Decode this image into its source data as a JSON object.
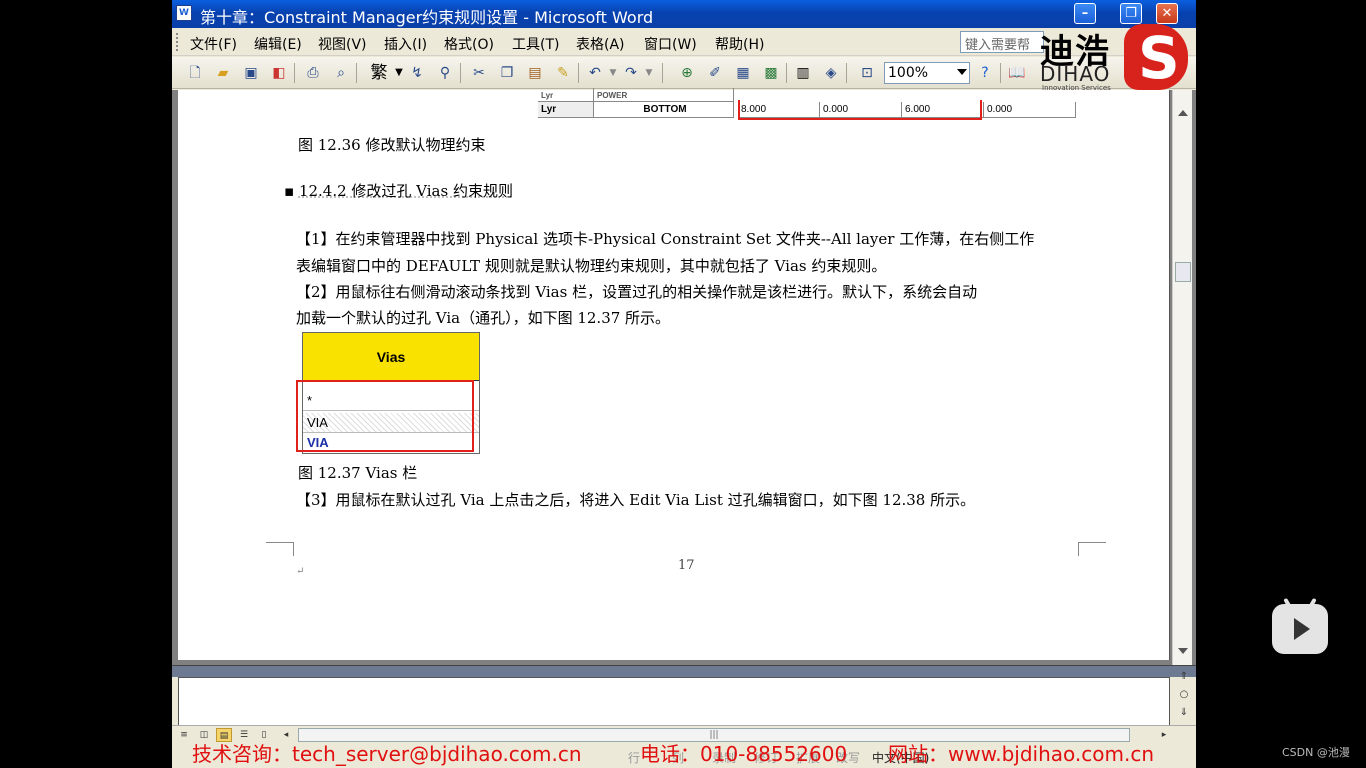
{
  "window": {
    "title": "第十章：Constraint Manager约束规则设置 - Microsoft Word",
    "app_icon": "W",
    "buttons": {
      "minimize": "–",
      "restore": "❐",
      "close": "✕"
    }
  },
  "menu": {
    "items": [
      "文件(F)",
      "编辑(E)",
      "视图(V)",
      "插入(I)",
      "格式(O)",
      "工具(T)",
      "表格(A)",
      "窗口(W)",
      "帮助(H)"
    ],
    "help_placeholder": "键入需要帮"
  },
  "toolbar": {
    "zoom": "100%",
    "trad_char": "繁"
  },
  "logo": {
    "cn": "迪浩",
    "en": "DIHAO",
    "sub": "Innovation Services",
    "mark_glyph": "S"
  },
  "document": {
    "top_table": {
      "row_label": "Lyr",
      "layer": "BOTTOM",
      "values": [
        "8.000",
        "0.000",
        "6.000",
        "0.000"
      ],
      "prev_row_label": "Lyr",
      "prev_layer": "POWER"
    },
    "fig_1236_caption": "图 12.36  修改默认物理约束",
    "heading": "12.4.2  修改过孔 Vias 约束规则",
    "para1_line1": "【1】在约束管理器中找到 Physical 选项卡-Physical Constraint Set 文件夹--All layer 工作薄，在右侧工作",
    "para1_line2": "表编辑窗口中的 DEFAULT 规则就是默认物理约束规则，其中就包括了 Vias 约束规则。",
    "para2_line1": "【2】用鼠标往右侧滑动滚动条找到 Vias 栏，设置过孔的相关操作就是该栏进行。默认下，系统会自动",
    "para2_line2": "加载一个默认的过孔 Via（通孔），如下图 12.37 所示。",
    "vias_figure": {
      "header": "Vias",
      "rows": [
        "*",
        "VIA",
        "VIA"
      ]
    },
    "fig_1237_caption": "图 12.37 Vias 栏",
    "para3": "【3】用鼠标在默认过孔 Via 上点击之后，将进入 Edit Via List 过孔编辑窗口，如下图 12.38 所示。",
    "page_number": "17",
    "return_mark": "↵"
  },
  "status": {
    "ad_email": "技术咨询：tech_server@bjdihao.com.cn",
    "ad_phone": "电话：010-88552600",
    "ad_site": "网站：www.bjdihao.com.cn",
    "faint_items": [
      "行",
      "列",
      "录制",
      "修订",
      "扩展",
      "改写",
      "中文(中国)"
    ]
  },
  "overlay": {
    "watermark": "CSDN @池漫"
  },
  "colors": {
    "title_bar": "#0a4fc8",
    "vias_header": "#f9e100",
    "highlight_red": "#e0201a",
    "ad_red": "#e01010"
  }
}
